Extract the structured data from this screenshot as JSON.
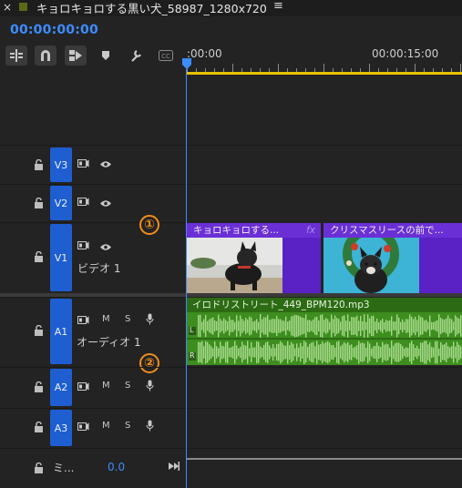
{
  "sequence": {
    "title": "キョロキョロする黒い犬_58987_1280x720",
    "close_glyph": "×",
    "menu_glyph": "≡",
    "color": "#5a6a1a"
  },
  "timecode": "00:00:00:00",
  "ruler": {
    "start_label": ":00:00",
    "mark_label": "00:00:15:00"
  },
  "toolbar": [
    {
      "name": "insert-overwrite-icon",
      "glyph": "⫶"
    },
    {
      "name": "snap-magnet-icon",
      "glyph": "∩"
    },
    {
      "name": "linked-selection-icon",
      "glyph": "⬗"
    },
    {
      "name": "add-marker-icon",
      "glyph": "♥"
    },
    {
      "name": "settings-wrench-icon",
      "glyph": "🔧"
    },
    {
      "name": "captions-icon",
      "glyph": "CC"
    }
  ],
  "tracks": {
    "video": [
      {
        "id": "V3",
        "name": ""
      },
      {
        "id": "V2",
        "name": ""
      },
      {
        "id": "V1",
        "name": "ビデオ 1"
      }
    ],
    "audio": [
      {
        "id": "A1",
        "name": "オーディオ 1",
        "m": "M",
        "s": "S"
      },
      {
        "id": "A2",
        "name": "",
        "m": "M",
        "s": "S"
      },
      {
        "id": "A3",
        "name": "",
        "m": "M",
        "s": "S"
      }
    ],
    "master": {
      "label": "ミ...",
      "value": "0.0"
    }
  },
  "clips": {
    "video1": {
      "title": "キョロキョロする...",
      "fx": "fx"
    },
    "video2": {
      "title": "クリスマスリースの前で..."
    },
    "audio1": {
      "title": "イロドリストリート_449_BPM120.mp3",
      "left_ch": "L",
      "right_ch": "R"
    }
  },
  "annotations": [
    "①",
    "②"
  ],
  "colors": {
    "accent": "#3d8cff",
    "track_target": "#1e5ed0",
    "video_clip": "#6b2fd6",
    "audio_clip": "#3d8d1f",
    "annotation": "#f08c1e",
    "work_area": "#e6c400"
  }
}
